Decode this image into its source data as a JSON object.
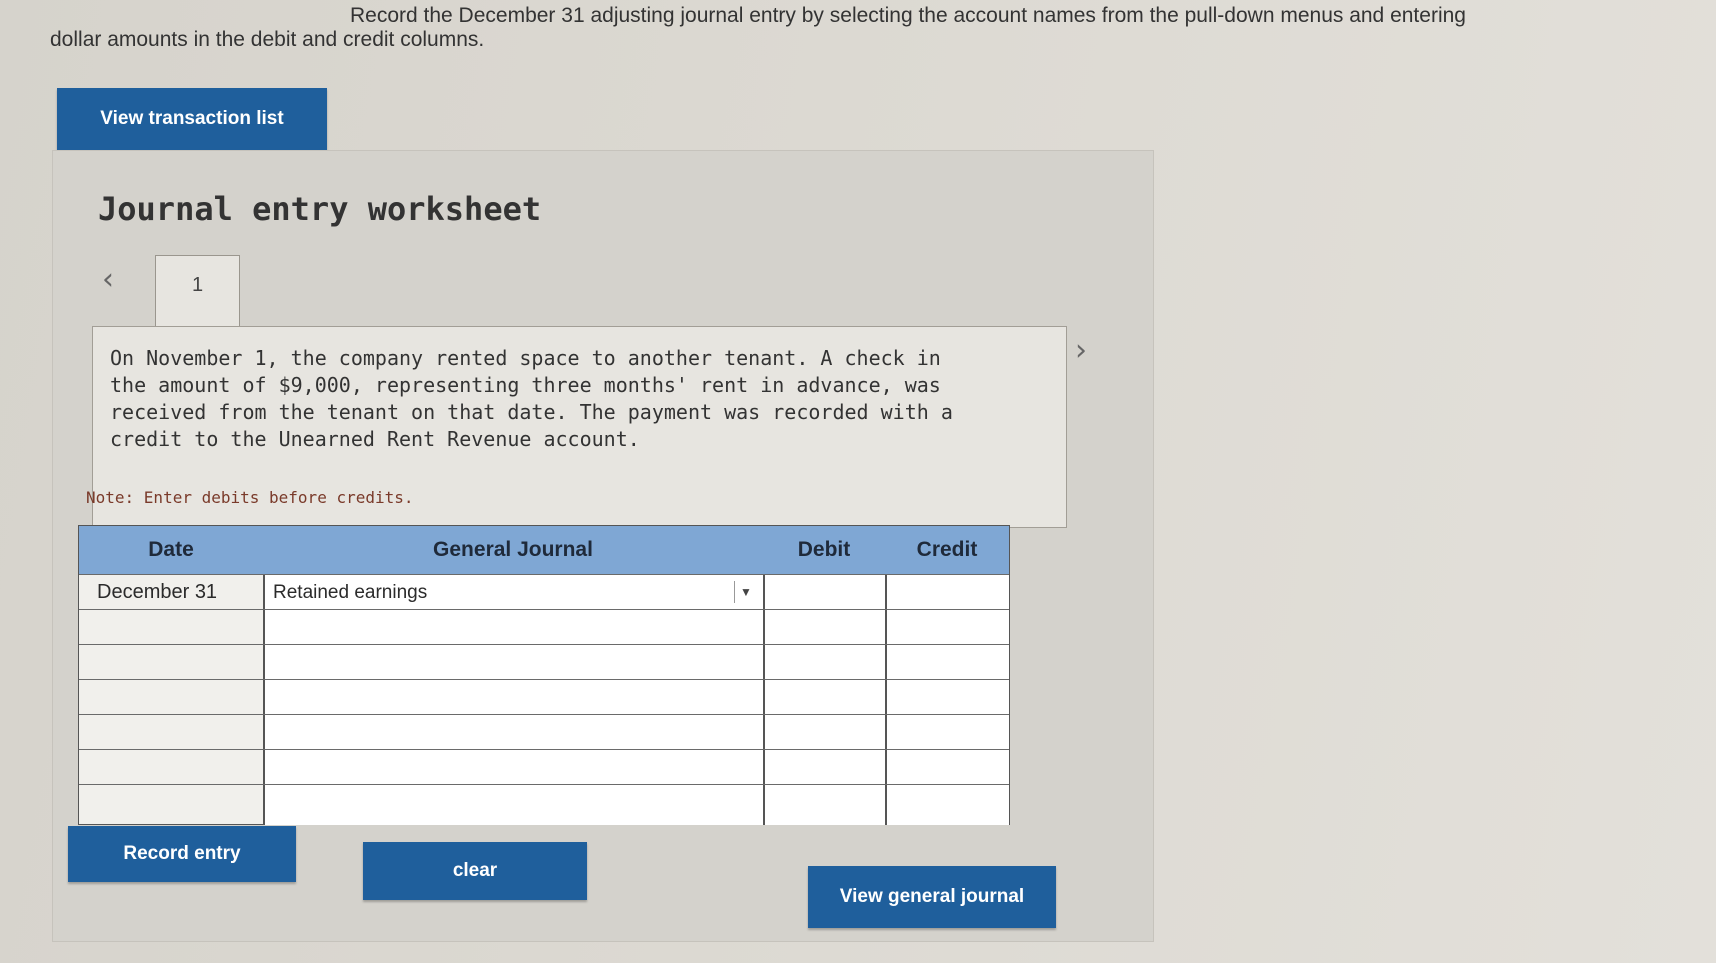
{
  "instructions": {
    "line1": "Record the December 31 adjusting journal entry by selecting the account names from the pull-down menus and entering",
    "line2": "dollar amounts in the debit and credit columns."
  },
  "buttons": {
    "view_transactions": "View transaction list",
    "record_entry": "Record entry",
    "clear": "clear",
    "view_general_journal": "View general journal"
  },
  "worksheet": {
    "title": "Journal entry worksheet",
    "active_tab": "1",
    "description": "On November 1, the company rented space to another tenant. A check in the amount of $9,000, representing three months' rent in advance, was received from the tenant on that date. The payment was recorded with a credit to the Unearned Rent Revenue account.",
    "note": "Note: Enter debits before credits."
  },
  "journal": {
    "headers": {
      "date": "Date",
      "general_journal": "General Journal",
      "debit": "Debit",
      "credit": "Credit"
    },
    "rows": [
      {
        "date": "December 31",
        "account": "Retained earnings",
        "debit": "",
        "credit": ""
      },
      {
        "date": "",
        "account": "",
        "debit": "",
        "credit": ""
      },
      {
        "date": "",
        "account": "",
        "debit": "",
        "credit": ""
      },
      {
        "date": "",
        "account": "",
        "debit": "",
        "credit": ""
      },
      {
        "date": "",
        "account": "",
        "debit": "",
        "credit": ""
      },
      {
        "date": "",
        "account": "",
        "debit": "",
        "credit": ""
      },
      {
        "date": "",
        "account": "",
        "debit": "",
        "credit": ""
      }
    ]
  },
  "icons": {
    "prev": "chevron-left-icon",
    "next": "chevron-right-icon",
    "dropdown": "chevron-down-icon"
  },
  "colors": {
    "button": "#1f5f9c",
    "header": "#7fa7d4"
  }
}
